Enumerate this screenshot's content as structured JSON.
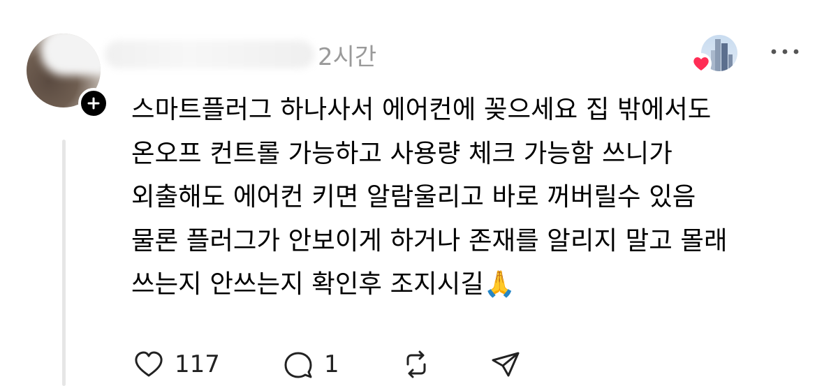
{
  "post": {
    "username": "",
    "time": "2시간",
    "text": "스마트플러그 하나사서 에어컨에 꽂으세요 집 밖에서도\n온오프 컨트롤 가능하고 사용량 체크 가능함 쓰니가\n외출해도 에어컨 키면 알람울리고 바로 꺼버릴수 있음\n물론 플러그가 안보이게 하거나 존재를 알리지 말고 몰래\n쓰는지 안쓰는지 확인후 조지시길🙏",
    "reactions": {
      "likes": "117",
      "replies": "1"
    }
  },
  "icons": {
    "follow": "plus-icon",
    "heart": "heart-icon",
    "more": "more-icon",
    "like": "like-icon",
    "reply": "reply-icon",
    "repost": "repost-icon",
    "share": "share-icon"
  },
  "colors": {
    "heart": "#ff2d55",
    "meta": "#9a9a9a"
  }
}
